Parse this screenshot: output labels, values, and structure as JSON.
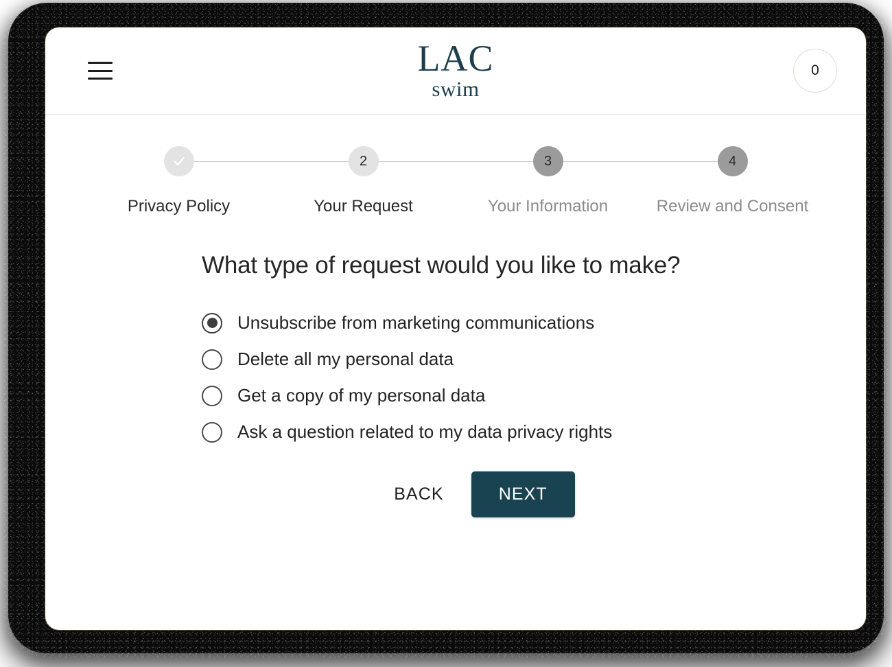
{
  "header": {
    "menu_icon": "hamburger-menu-icon",
    "brand_main": "LAC",
    "brand_sub": "swim",
    "cart_count": "0"
  },
  "stepper": {
    "steps": [
      {
        "marker": "✓",
        "label": "Privacy Policy",
        "state": "completed",
        "circle_tone": "light"
      },
      {
        "marker": "2",
        "label": "Your Request",
        "state": "current",
        "circle_tone": "light"
      },
      {
        "marker": "3",
        "label": "Your Information",
        "state": "upcoming",
        "circle_tone": "dark"
      },
      {
        "marker": "4",
        "label": "Review and Consent",
        "state": "upcoming",
        "circle_tone": "dark"
      }
    ]
  },
  "form": {
    "question": "What type of request would you like to make?",
    "options": [
      {
        "label": "Unsubscribe from marketing communications",
        "selected": true
      },
      {
        "label": "Delete all my personal data",
        "selected": false
      },
      {
        "label": "Get a copy of my personal data",
        "selected": false
      },
      {
        "label": "Ask a question related to my data privacy rights",
        "selected": false
      }
    ]
  },
  "actions": {
    "back_label": "BACK",
    "next_label": "NEXT"
  },
  "colors": {
    "brand": "#1d3f4c",
    "primary_button": "#1a4352",
    "step_light": "#e3e3e3",
    "step_dark": "#9b9b9b",
    "text_muted": "#8c8c8c",
    "divider": "#e6e4e1"
  }
}
